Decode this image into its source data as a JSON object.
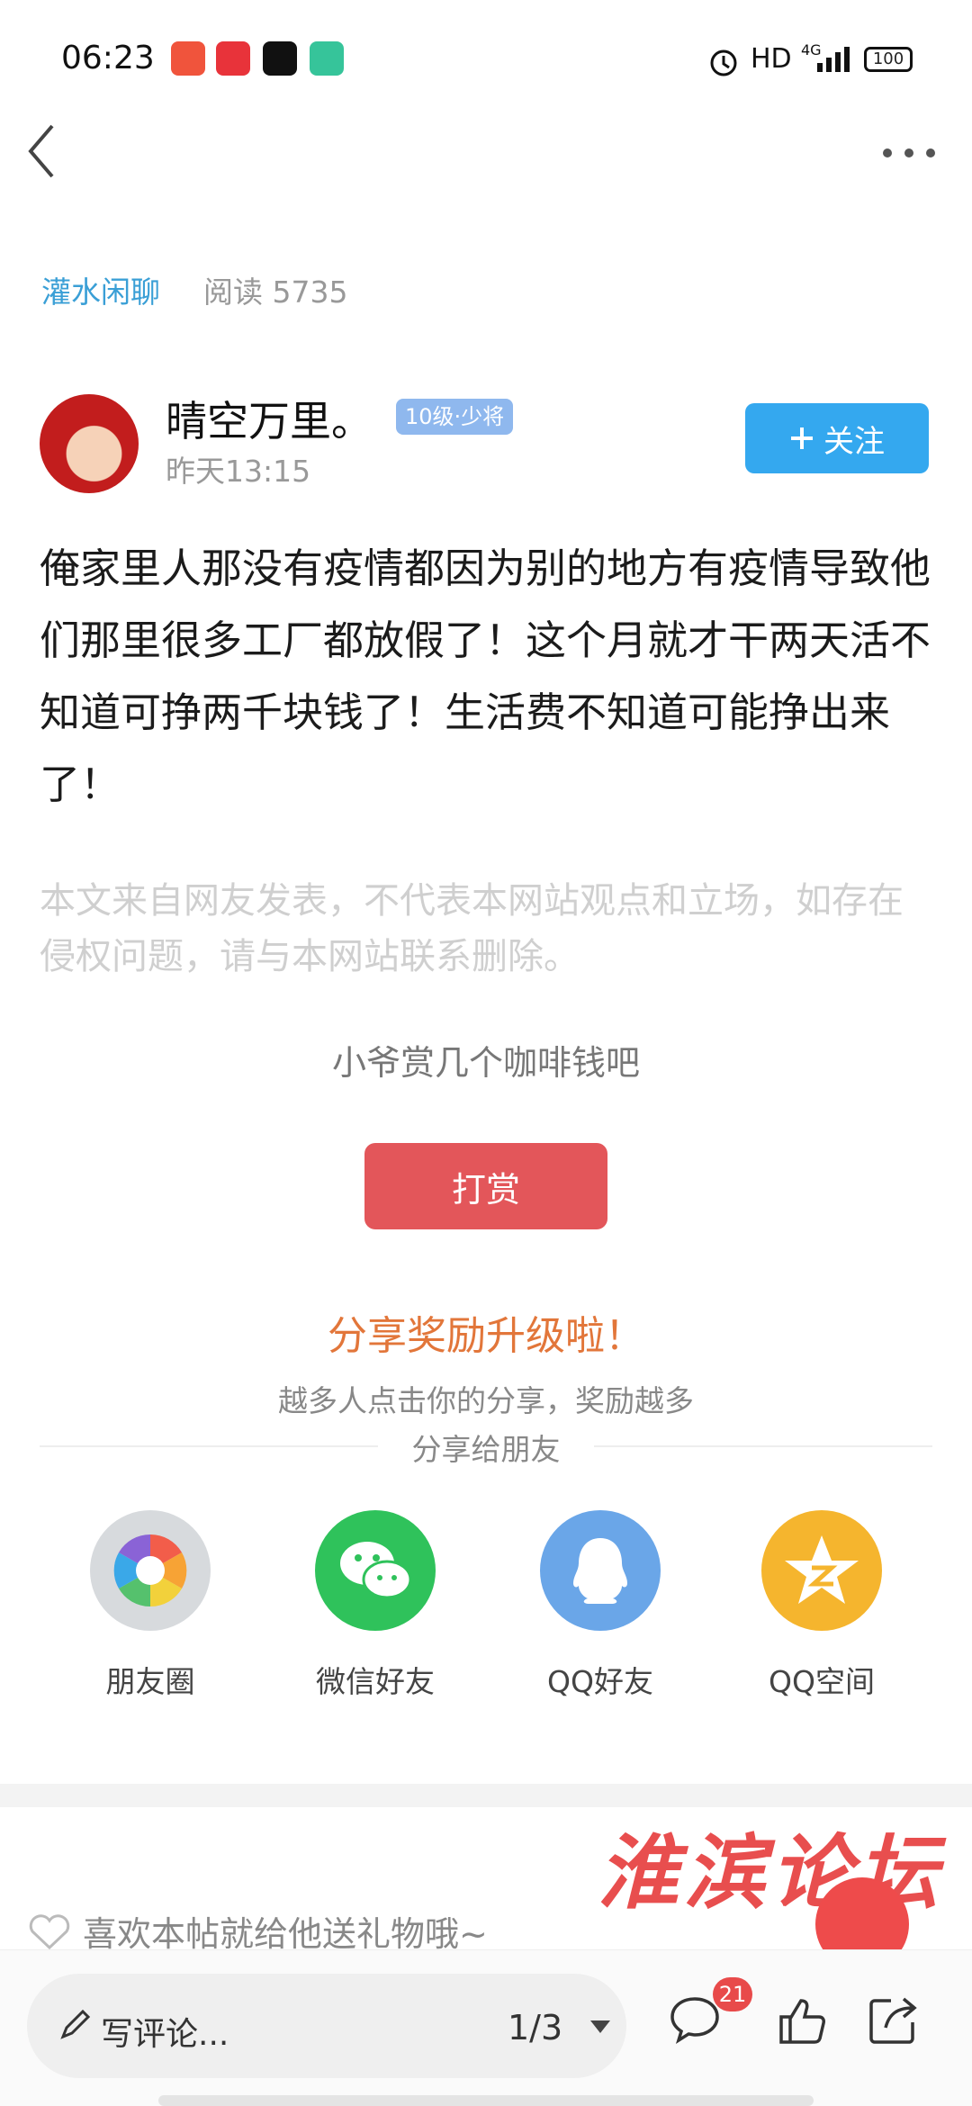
{
  "status_bar": {
    "time": "06:23",
    "network_label": "HD",
    "signal_label": "4G",
    "battery": "100",
    "apps": [
      {
        "icon": "app-icon-video",
        "color": "#f0543c"
      },
      {
        "icon": "app-icon-toutiao",
        "color": "#e8333a"
      },
      {
        "icon": "app-icon-douyin",
        "color": "#111111"
      },
      {
        "icon": "app-icon-chat",
        "color": "#36c49a"
      }
    ]
  },
  "nav": {
    "back_icon": "chevron-left-icon",
    "more_icon": "more-dots-icon"
  },
  "post_meta": {
    "category": "灌水闲聊",
    "reads": "阅读 5735"
  },
  "author": {
    "name": "晴空万里。",
    "level": "10级·少将",
    "time": "昨天13:15",
    "follow_label": "关注"
  },
  "post": {
    "body": "俺家里人那没有疫情都因为别的地方有疫情导致他们那里很多工厂都放假了！这个月就才干两天活不知道可挣两千块钱了！生活费不知道可能挣出来了！",
    "disclaimer": "本文来自网友发表，不代表本网站观点和立场，如存在侵权问题，请与本网站联系删除。"
  },
  "reward": {
    "hint": "小爷赏几个咖啡钱吧",
    "button_label": "打赏"
  },
  "share": {
    "title": "分享奖励升级啦！",
    "subtitle": "越多人点击你的分享，奖励越多",
    "friends_label": "分享给朋友",
    "targets": [
      {
        "label": "朋友圈",
        "icon": "moments-icon",
        "color": "#d7dadd"
      },
      {
        "label": "微信好友",
        "icon": "wechat-icon",
        "color": "#2fc25b"
      },
      {
        "label": "QQ好友",
        "icon": "qq-icon",
        "color": "#6aa6e8"
      },
      {
        "label": "QQ空间",
        "icon": "qzone-icon",
        "color": "#f5b52e"
      }
    ]
  },
  "gift": {
    "hint": "喜欢本帖就给他送礼物哦~",
    "watermark": "淮滨论坛"
  },
  "bottom_bar": {
    "comment_placeholder": "写评论...",
    "page": "1/3",
    "comment_count": "21"
  }
}
